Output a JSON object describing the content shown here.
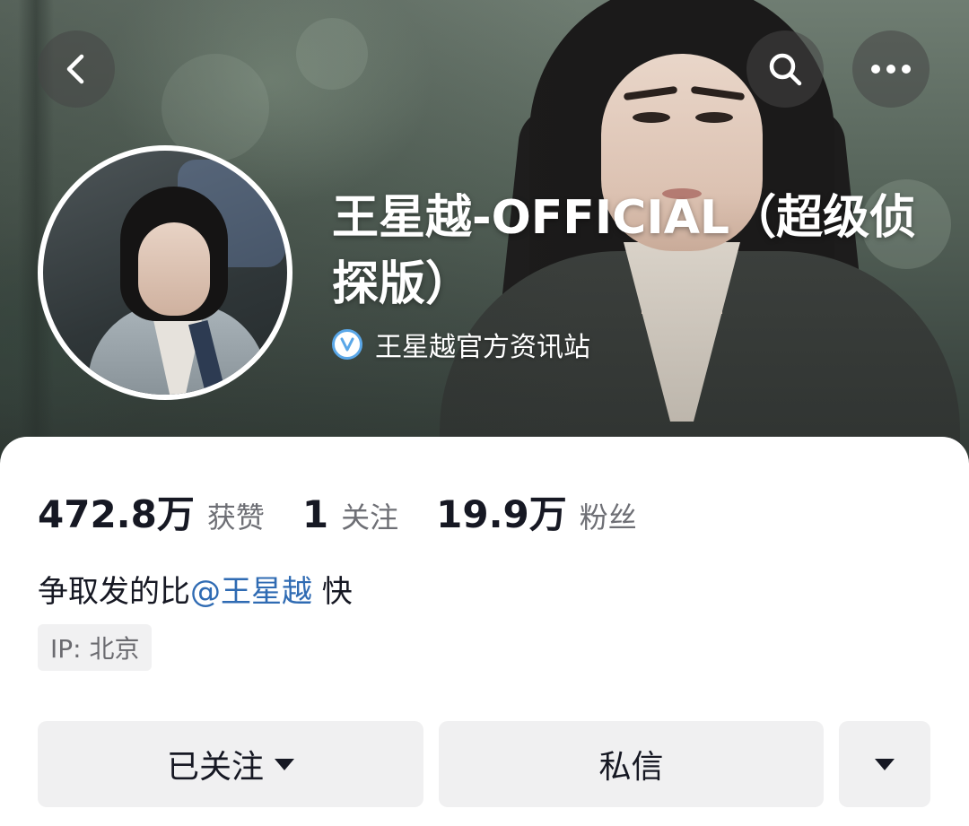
{
  "profile": {
    "name": "王星越-OFFICIAL（超级侦探版）",
    "verified_label": "王星越官方资讯站",
    "verified_color": "#5aa7e8"
  },
  "stats": [
    {
      "value": "472.8万",
      "label": "获赞"
    },
    {
      "value": "1",
      "label": "关注"
    },
    {
      "value": "19.9万",
      "label": "粉丝"
    }
  ],
  "bio": {
    "prefix": "争取发的比",
    "mention": "@王星越",
    "suffix": " 快",
    "mention_color": "#2f6bb3"
  },
  "ip_location": "IP: 北京",
  "actions": {
    "follow_label": "已关注",
    "message_label": "私信"
  },
  "icons": {
    "back": "chevron-left-icon",
    "search": "search-icon",
    "more": "more-dots-icon",
    "verified": "verified-v-icon",
    "dropdown": "caret-down-icon"
  }
}
